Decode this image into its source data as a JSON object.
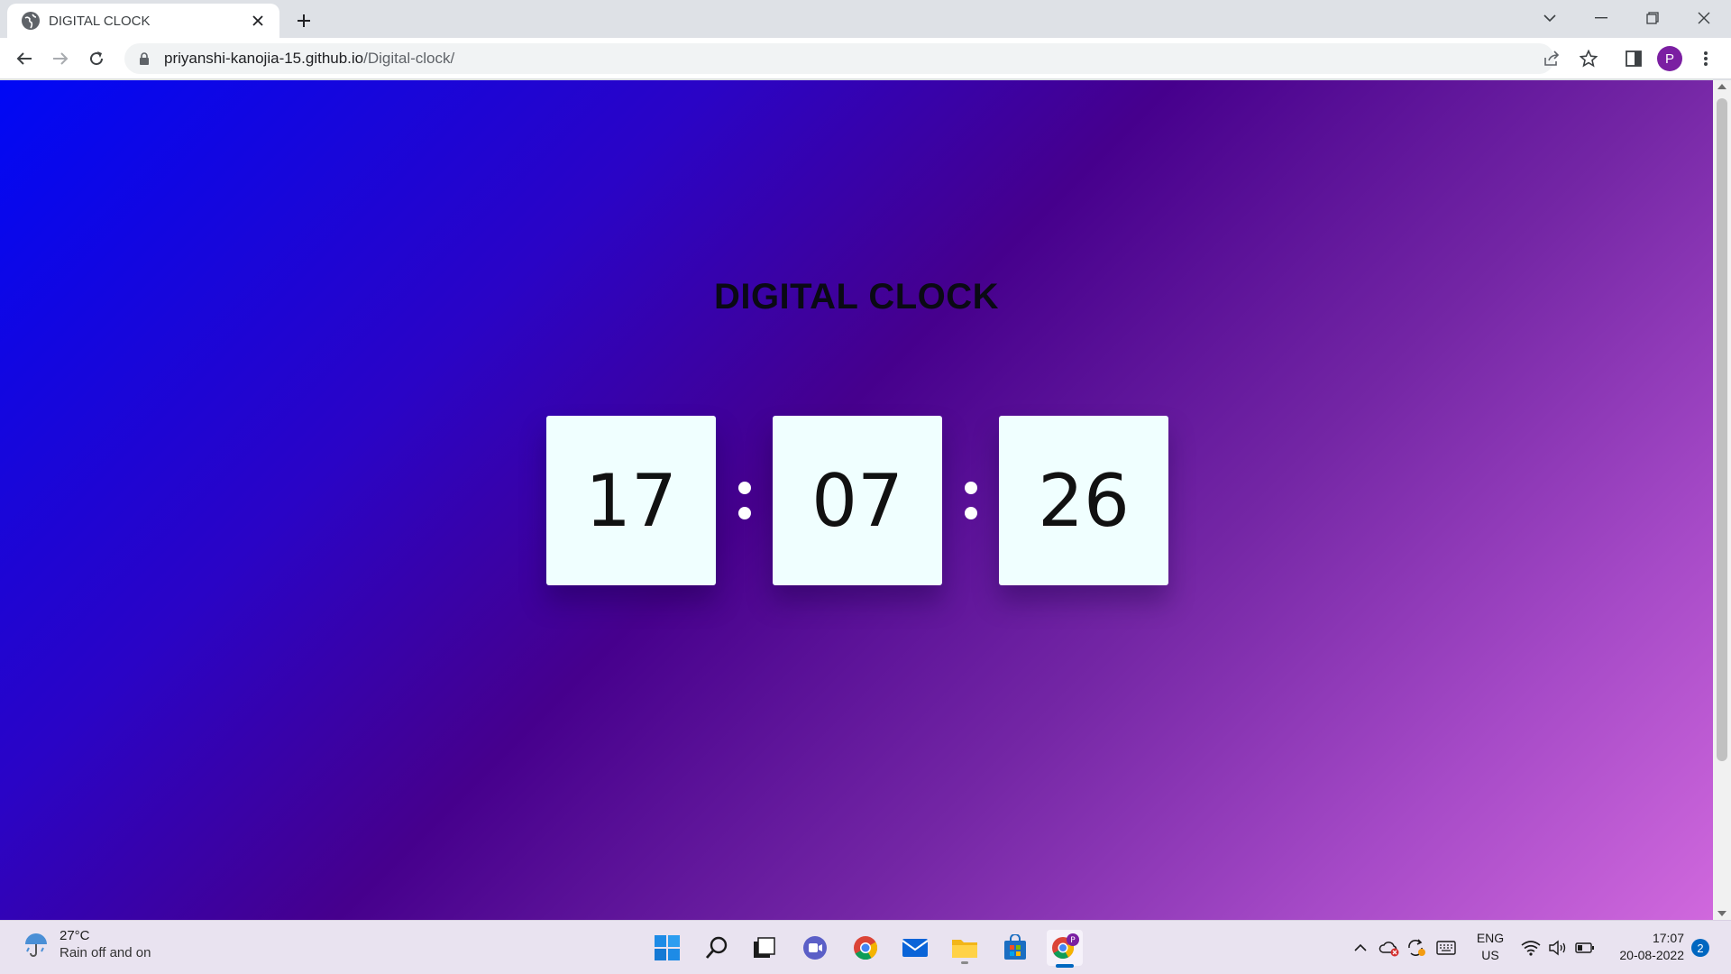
{
  "browser": {
    "tab_title": "DIGITAL CLOCK",
    "url_host": "priyanshi-kanojia-15.github.io",
    "url_path": "/Digital-clock/",
    "profile_initial": "P"
  },
  "page": {
    "heading": "DIGITAL CLOCK",
    "clock": {
      "hours": "17",
      "minutes": "07",
      "seconds": "26"
    }
  },
  "taskbar": {
    "weather": {
      "temperature": "27°C",
      "condition": "Rain off and on"
    },
    "language": {
      "line1": "ENG",
      "line2": "US"
    },
    "time": "17:07",
    "date": "20-08-2022",
    "notification_count": "2"
  },
  "colors": {
    "gradient_start": "#0008f5",
    "gradient_mid": "#46008d",
    "gradient_end": "#d068dd",
    "digit_box": "#f0ffff"
  }
}
